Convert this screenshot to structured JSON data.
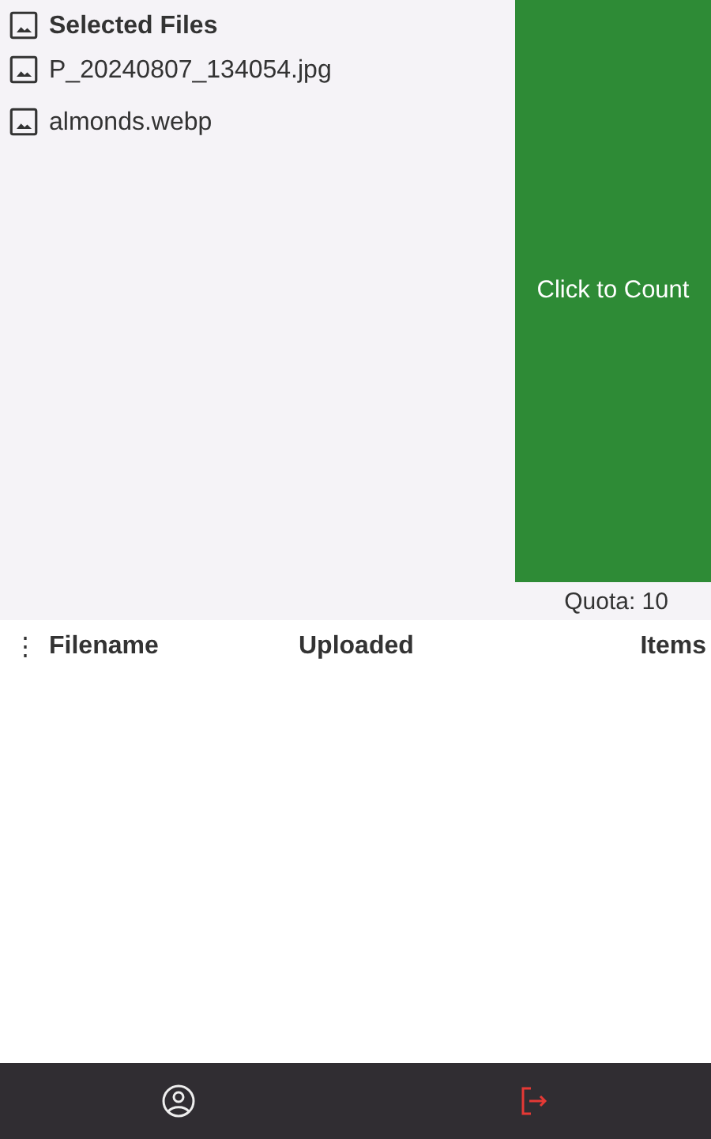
{
  "files": {
    "title": "Selected Files",
    "items": [
      {
        "name": "P_20240807_134054.jpg"
      },
      {
        "name": "almonds.webp"
      }
    ]
  },
  "count_button": {
    "label": "Click to Count"
  },
  "quota": "Quota: 10",
  "table": {
    "menu": "⋮",
    "columns": [
      "Filename",
      "Uploaded",
      "Items"
    ]
  },
  "nav": [
    {
      "kind": "account"
    },
    {
      "kind": "logout"
    }
  ]
}
